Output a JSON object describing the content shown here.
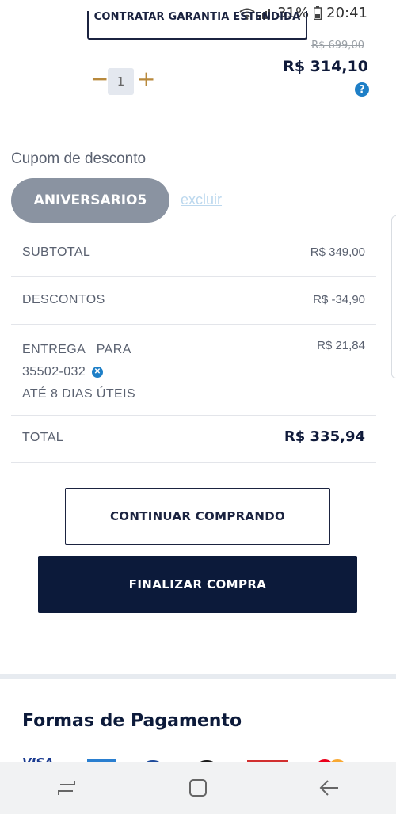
{
  "status_bar": {
    "battery": "31%",
    "time": "20:41"
  },
  "product": {
    "warranty_button": "CONTRATAR GARANTIA ESTENDIDA",
    "old_price": "R$ 699,00",
    "price": "R$ 314,10",
    "help_symbol": "?",
    "quantity": "1",
    "minus_symbol": "−",
    "plus_symbol": "+"
  },
  "coupon": {
    "title": "Cupom de desconto",
    "code": "ANIVERSARIO5",
    "remove_label": "excluir"
  },
  "summary": {
    "subtotal_label": "SUBTOTAL",
    "subtotal_value": "R$ 349,00",
    "discounts_label": "DESCONTOS",
    "discounts_value": "R$ -34,90",
    "shipping_label_line1": "ENTREGA   PARA",
    "shipping_cep": "35502-032",
    "shipping_label_line3": "ATÉ 8 DIAS ÚTEIS",
    "shipping_value": "R$ 21,84",
    "total_label": "TOTAL",
    "total_value": "R$ 335,94"
  },
  "actions": {
    "continue_label": "CONTINUAR COMPRANDO",
    "finish_label": "FINALIZAR COMPRA"
  },
  "payments": {
    "title": "Formas de Pagamento",
    "logos": [
      "visa-logo",
      "amex-logo",
      "diners-logo",
      "elo-logo",
      "hipercard-logo",
      "mastercard-logo"
    ]
  },
  "colors": {
    "navy": "#0c1a3a",
    "gold": "#b8893c",
    "link_blue": "#1e7fc7",
    "coupon_gray": "#8a93a1"
  }
}
